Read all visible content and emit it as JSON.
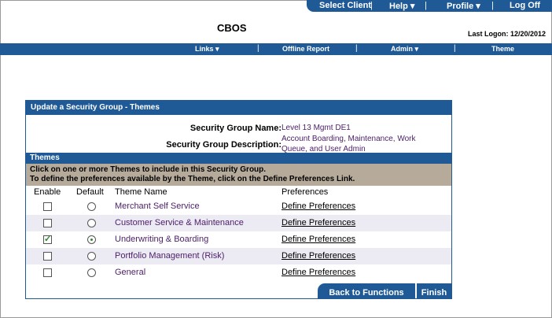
{
  "top_nav": {
    "select_client": "Select Client",
    "help": "Help ▾",
    "profile": "Profile ▾",
    "log_off": "Log Off"
  },
  "brand": "CBOS",
  "last_logon": "Last Logon: 12/20/2012",
  "sub_nav": {
    "links": "Links ▾",
    "offline_report": "Offline Report",
    "admin": "Admin ▾",
    "theme": "Theme"
  },
  "panel": {
    "title": "Update a Security Group - Themes",
    "group_name_label": "Security Group Name:",
    "group_name_value": "Level 13 Mgmt DE1",
    "group_desc_label": "Security Group Description:",
    "group_desc_line1": "Account Boarding, Maintenance, Work",
    "group_desc_line2": "Queue, and User Admin",
    "themes_label": "Themes",
    "instruction_1": "Click on one or more Themes to include in this Security Group.",
    "instruction_2": "To define the preferences available by the Theme, click on the Define Preferences Link.",
    "col_enable": "Enable",
    "col_default": "Default",
    "col_theme_name": "Theme Name",
    "col_preferences": "Preferences",
    "rows": [
      {
        "name": "Merchant Self Service",
        "enabled": false,
        "default": false,
        "pref": "Define Preferences"
      },
      {
        "name": "Customer Service & Maintenance",
        "enabled": false,
        "default": false,
        "pref": "Define Preferences"
      },
      {
        "name": "Underwriting & Boarding",
        "enabled": true,
        "default": true,
        "pref": "Define Preferences"
      },
      {
        "name": "Portfolio Management (Risk)",
        "enabled": false,
        "default": false,
        "pref": "Define Preferences"
      },
      {
        "name": "General",
        "enabled": false,
        "default": false,
        "pref": "Define Preferences"
      }
    ],
    "back_button": "Back to Functions",
    "finish_button": "Finish"
  },
  "colors": {
    "nav_blue": "#1f5a96",
    "instruction_bg": "#b6ab9b",
    "value_purple": "#4b1e69"
  }
}
